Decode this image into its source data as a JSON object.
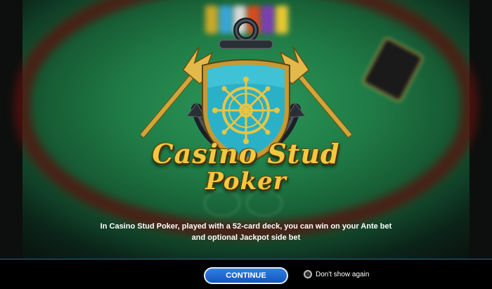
{
  "game": {
    "title_line1": "Casino Stud",
    "title_line2": "Poker"
  },
  "intro": {
    "message": "In Casino Stud Poker, played with a 52-card deck, you can win on your Ante bet and optional Jackpot side bet"
  },
  "controls": {
    "continue_label": "CONTINUE",
    "dont_show_label": "Don't show again",
    "dont_show_checked": false
  },
  "colors": {
    "felt": "#1f7a45",
    "shield": "#2fb6c9",
    "gold": "#f3c83e",
    "button": "#1e6fd6"
  }
}
